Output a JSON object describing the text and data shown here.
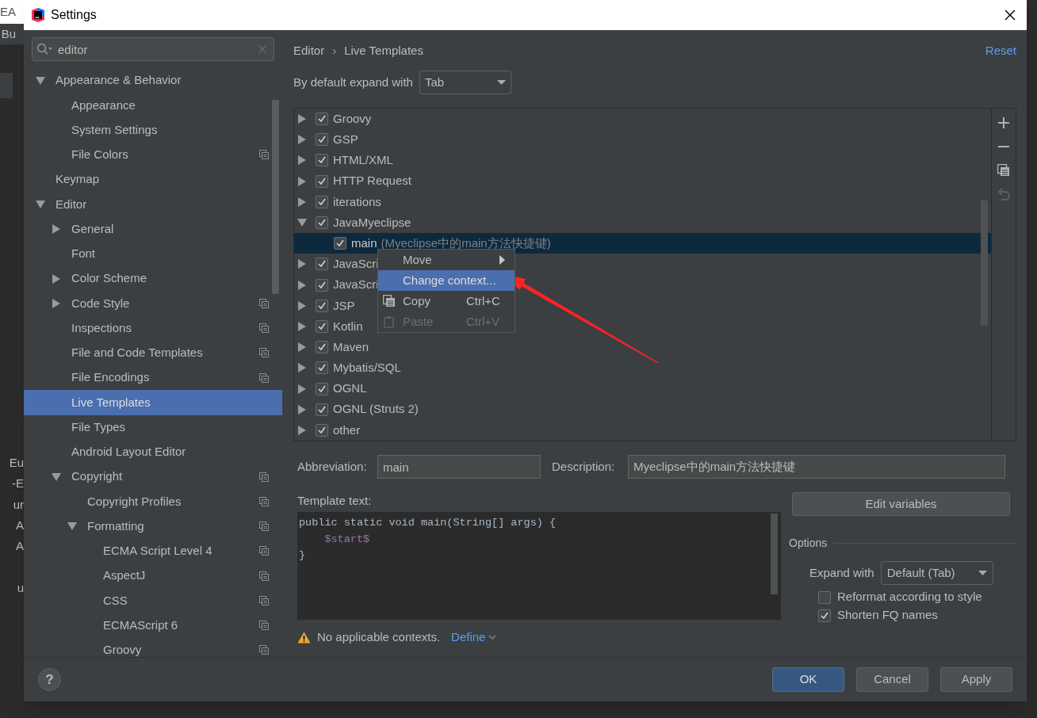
{
  "window": {
    "title": "Settings"
  },
  "background": {
    "fragments": [
      "EA",
      "Bu",
      "Eu",
      "-E",
      "ur",
      "A",
      "A",
      "u"
    ]
  },
  "search": {
    "value": "editor"
  },
  "sidebar": {
    "items": [
      {
        "label": "Appearance & Behavior",
        "expanded": true,
        "scope_icon": false,
        "selected": false,
        "children": [
          {
            "label": "Appearance",
            "scope_icon": false,
            "selected": false
          },
          {
            "label": "System Settings",
            "scope_icon": false,
            "selected": false
          },
          {
            "label": "File Colors",
            "scope_icon": true,
            "selected": false
          }
        ]
      },
      {
        "label": "Keymap",
        "scope_icon": false,
        "selected": false
      },
      {
        "label": "Editor",
        "expanded": true,
        "scope_icon": false,
        "selected": false,
        "children": [
          {
            "label": "General",
            "expanded": false,
            "scope_icon": false,
            "selected": false
          },
          {
            "label": "Font",
            "scope_icon": false,
            "selected": false
          },
          {
            "label": "Color Scheme",
            "expanded": false,
            "scope_icon": false,
            "selected": false
          },
          {
            "label": "Code Style",
            "expanded": false,
            "scope_icon": true,
            "selected": false
          },
          {
            "label": "Inspections",
            "scope_icon": true,
            "selected": false
          },
          {
            "label": "File and Code Templates",
            "scope_icon": true,
            "selected": false
          },
          {
            "label": "File Encodings",
            "scope_icon": true,
            "selected": false
          },
          {
            "label": "Live Templates",
            "scope_icon": false,
            "selected": true
          },
          {
            "label": "File Types",
            "scope_icon": false,
            "selected": false
          },
          {
            "label": "Android Layout Editor",
            "scope_icon": false,
            "selected": false
          },
          {
            "label": "Copyright",
            "expanded": true,
            "scope_icon": true,
            "selected": false,
            "children": [
              {
                "label": "Copyright Profiles",
                "scope_icon": true,
                "selected": false
              },
              {
                "label": "Formatting",
                "expanded": true,
                "scope_icon": true,
                "selected": false,
                "children": [
                  {
                    "label": "ECMA Script Level 4",
                    "scope_icon": true,
                    "selected": false
                  },
                  {
                    "label": "AspectJ",
                    "scope_icon": true,
                    "selected": false
                  },
                  {
                    "label": "CSS",
                    "scope_icon": true,
                    "selected": false
                  },
                  {
                    "label": "ECMAScript 6",
                    "scope_icon": true,
                    "selected": false
                  },
                  {
                    "label": "Groovy",
                    "scope_icon": true,
                    "selected": false
                  }
                ]
              }
            ]
          }
        ]
      }
    ]
  },
  "breadcrumb": {
    "items": [
      "Editor",
      "Live Templates"
    ],
    "separator": "›"
  },
  "reset_link": "Reset",
  "expand_default": {
    "label": "By default expand with",
    "value": "Tab"
  },
  "template_tree": {
    "groups": [
      {
        "label": "Groovy",
        "checked": true,
        "expanded": false
      },
      {
        "label": "GSP",
        "checked": true,
        "expanded": false
      },
      {
        "label": "HTML/XML",
        "checked": true,
        "expanded": false
      },
      {
        "label": "HTTP Request",
        "checked": true,
        "expanded": false
      },
      {
        "label": "iterations",
        "checked": true,
        "expanded": false
      },
      {
        "label": "JavaMyeclipse",
        "checked": true,
        "expanded": true,
        "children": [
          {
            "label": "main",
            "description": "(Myeclipse中的main方法快捷键)",
            "checked": true,
            "selected": true
          }
        ]
      },
      {
        "label": "JavaScri",
        "checked": true,
        "expanded": false
      },
      {
        "label": "JavaScri",
        "checked": true,
        "expanded": false
      },
      {
        "label": "JSP",
        "checked": true,
        "expanded": false
      },
      {
        "label": "Kotlin",
        "checked": true,
        "expanded": false
      },
      {
        "label": "Maven",
        "checked": true,
        "expanded": false
      },
      {
        "label": "Mybatis/SQL",
        "checked": true,
        "expanded": false
      },
      {
        "label": "OGNL",
        "checked": true,
        "expanded": false
      },
      {
        "label": "OGNL (Struts 2)",
        "checked": true,
        "expanded": false
      },
      {
        "label": "other",
        "checked": true,
        "expanded": false
      }
    ]
  },
  "toolbar": [
    {
      "kind": "add",
      "disabled": false
    },
    {
      "kind": "remove",
      "disabled": false
    },
    {
      "kind": "copy",
      "disabled": false
    },
    {
      "kind": "restore",
      "disabled": true
    }
  ],
  "context_menu": {
    "items": [
      {
        "label": "Move",
        "kind": "submenu",
        "selected": false,
        "disabled": false
      },
      {
        "label": "Change context...",
        "kind": "action",
        "selected": true,
        "disabled": false
      },
      {
        "label": "Copy",
        "shortcut": "Ctrl+C",
        "kind": "copy",
        "selected": false,
        "disabled": false
      },
      {
        "label": "Paste",
        "shortcut": "Ctrl+V",
        "kind": "paste",
        "selected": false,
        "disabled": true
      }
    ]
  },
  "abbreviation": {
    "label": "Abbreviation:",
    "value": "main"
  },
  "description": {
    "label": "Description:",
    "value": "Myeclipse中的main方法快捷键"
  },
  "template_text": {
    "label": "Template text:",
    "lines": [
      {
        "text": "public static void main(String[] args) {",
        "kind": "code"
      },
      {
        "text": "    $start$",
        "kind": "variable"
      },
      {
        "text": "}",
        "kind": "code"
      }
    ]
  },
  "warning": {
    "text": "No applicable contexts.",
    "link": "Define"
  },
  "edit_variables_button": "Edit variables",
  "options": {
    "title": "Options",
    "expand_with": {
      "label": "Expand with",
      "value": "Default (Tab)"
    },
    "checkboxes": [
      {
        "label": "Reformat according to style",
        "checked": false
      },
      {
        "label": "Shorten FQ names",
        "checked": true
      }
    ]
  },
  "help_button": "?",
  "buttons": [
    {
      "label": "OK",
      "primary": true
    },
    {
      "label": "Cancel",
      "primary": false
    },
    {
      "label": "Apply",
      "primary": false
    }
  ]
}
